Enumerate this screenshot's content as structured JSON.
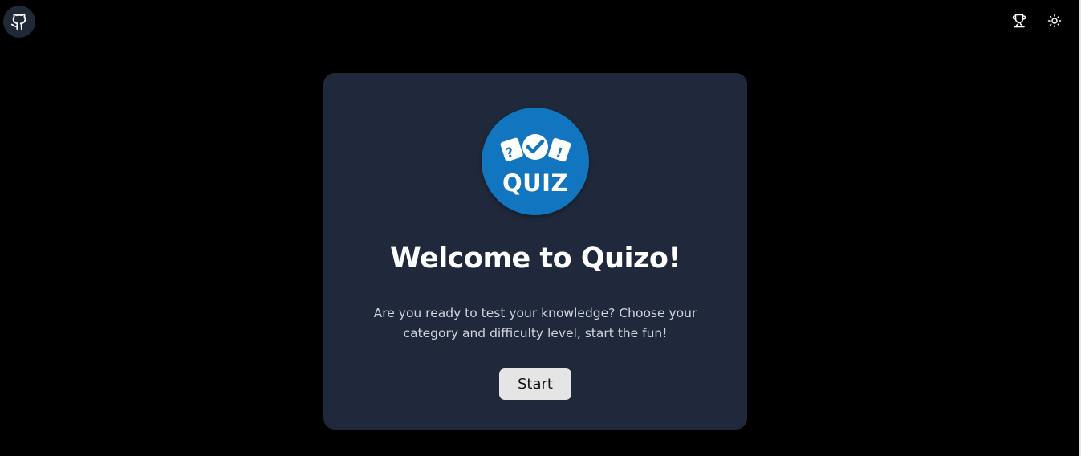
{
  "header": {
    "github_icon": "github-icon",
    "trophy_icon": "trophy-icon",
    "theme_icon": "sun-icon"
  },
  "card": {
    "logo_text": "QUIZ",
    "logo_marks": [
      "?",
      "!"
    ],
    "title": "Welcome to Quizo!",
    "description": "Are you ready to test your knowledge? Choose your category and difficulty level, start the fun!",
    "start_label": "Start"
  },
  "colors": {
    "background": "#000000",
    "card": "#1f293b",
    "logo_blue": "#1175bf",
    "button": "#e5e5e5"
  }
}
